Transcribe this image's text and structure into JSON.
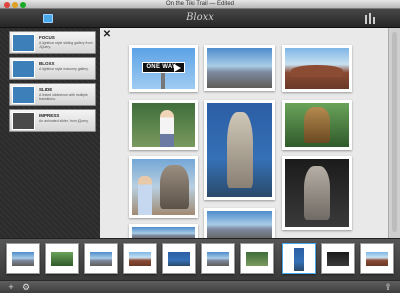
{
  "window": {
    "title": "On the Tiki Trail — Edited"
  },
  "toolbar": {
    "brand": "Bloxx",
    "left_icon": "slideshow-panel-icon",
    "right_icon": "adjust-sliders-icon"
  },
  "sidebar": {
    "items": [
      {
        "name": "FOCUS",
        "desc": "A lightbox style sliding gallery from JQuery."
      },
      {
        "name": "BLOXX",
        "desc": "A lightbox style masonry gallery."
      },
      {
        "name": "SLIDE",
        "desc": "A linked slideshow with multiple transitions."
      },
      {
        "name": "IMPRESS",
        "desc": "An animated slider, from jQuery."
      }
    ]
  },
  "main": {
    "close_glyph": "✕",
    "sign_text": "ONE WAY"
  },
  "filmstrip": {
    "count": 10,
    "selected_index": 7
  },
  "bottombar": {
    "add_glyph": "+",
    "settings_glyph": "⚙",
    "share_glyph": "⇪"
  },
  "colors": {
    "accent": "#4aa7e8",
    "sidebar_bg": "#2b2b2b",
    "main_bg": "#e9e9e9"
  }
}
